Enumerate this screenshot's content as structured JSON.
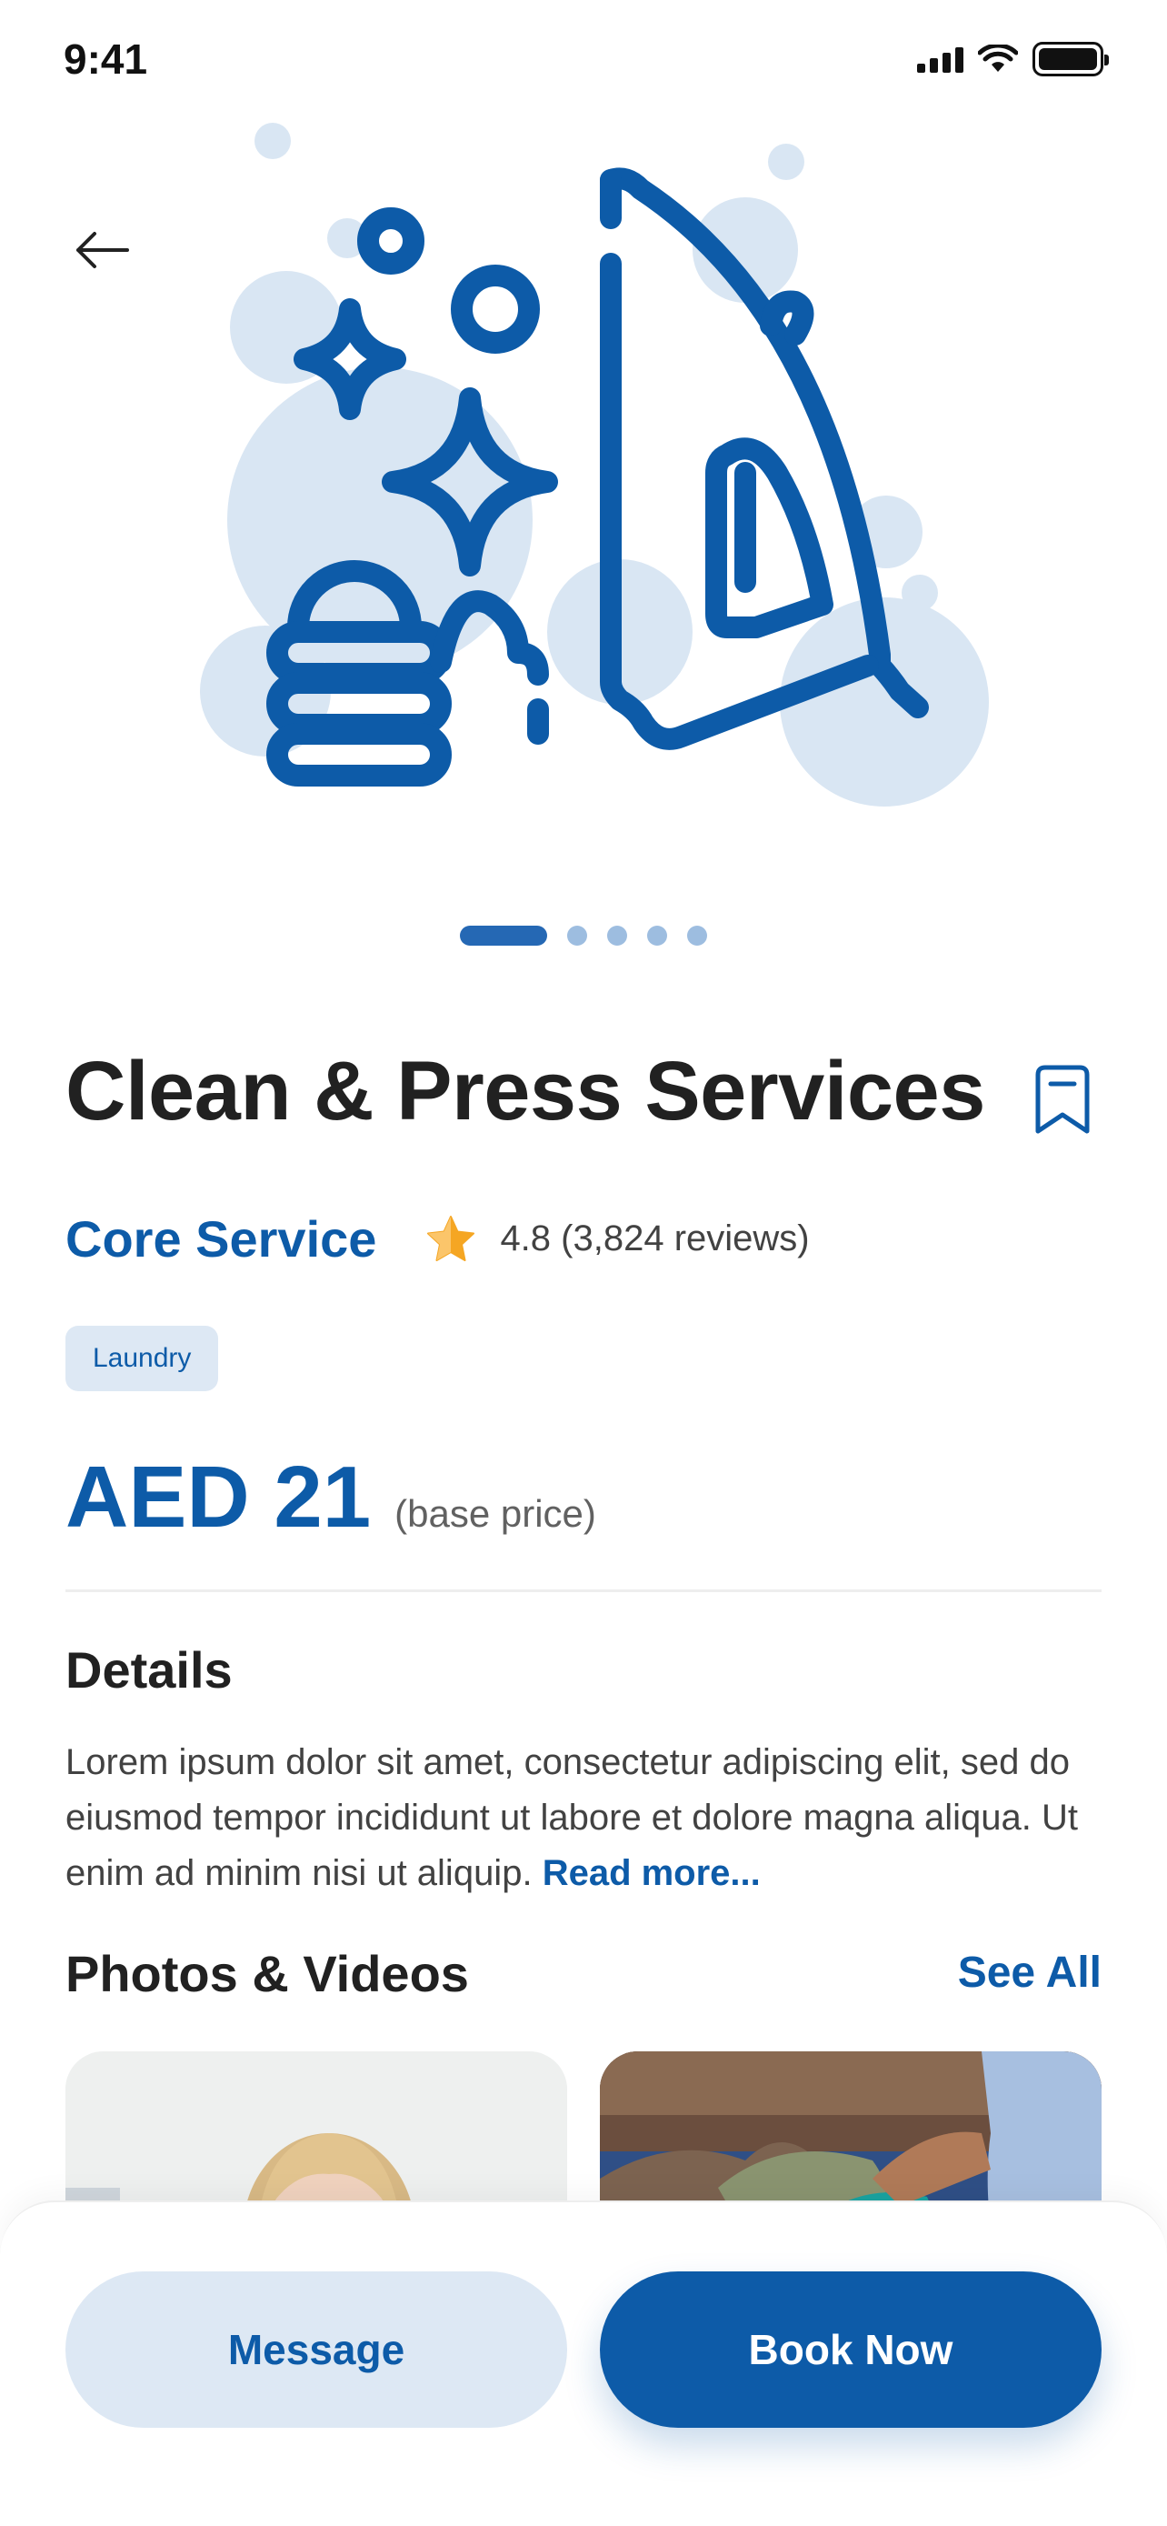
{
  "status_bar": {
    "time": "9:41"
  },
  "carousel": {
    "slide_count": 5,
    "active_index": 0
  },
  "service": {
    "title": "Clean & Press Services",
    "category": "Core Service",
    "rating_text": "4.8 (3,824 reviews)",
    "tag": "Laundry",
    "price": "AED 21",
    "price_note": "(base price)"
  },
  "details": {
    "heading": "Details",
    "text": "Lorem ipsum dolor sit amet, consectetur adipiscing elit, sed do eiusmod tempor incididunt ut labore et dolore magna aliqua. Ut enim ad minim nisi ut aliquip.",
    "read_more": "Read more..."
  },
  "photos": {
    "heading": "Photos & Videos",
    "see_all": "See All"
  },
  "actions": {
    "message": "Message",
    "book": "Book Now"
  },
  "icons": {
    "back": "arrow-left-icon",
    "bookmark": "bookmark-icon",
    "star": "star-icon",
    "hero": "iron-and-folded-clothes-illustration"
  },
  "colors": {
    "primary": "#0d5ba8",
    "primary_light": "#dde8f4",
    "bubble": "#d9e6f3",
    "star": "#f5a623"
  }
}
